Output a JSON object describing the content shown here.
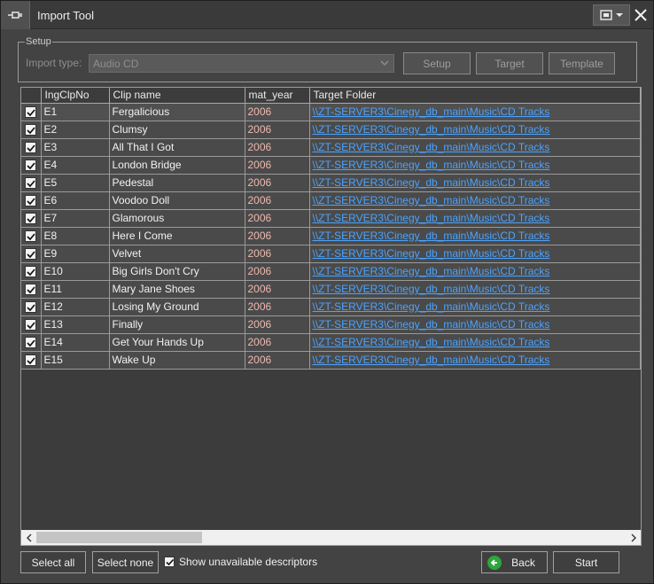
{
  "window": {
    "title": "Import Tool"
  },
  "setup": {
    "legend": "Setup",
    "import_type_label": "Import type:",
    "import_type_value": "Audio CD",
    "buttons": [
      "Setup",
      "Target",
      "Template"
    ]
  },
  "grid": {
    "columns": [
      "IngClpNo",
      "Clip name",
      "mat_year",
      "Target Folder"
    ],
    "rows": [
      {
        "checked": true,
        "no": "E1",
        "name": "Fergalicious",
        "year": "2006",
        "folder": "\\\\ZT-SERVER3\\Cinegy_db_main\\Music\\CD Tracks"
      },
      {
        "checked": true,
        "no": "E2",
        "name": "Clumsy",
        "year": "2006",
        "folder": "\\\\ZT-SERVER3\\Cinegy_db_main\\Music\\CD Tracks"
      },
      {
        "checked": true,
        "no": "E3",
        "name": "All That I Got",
        "year": "2006",
        "folder": "\\\\ZT-SERVER3\\Cinegy_db_main\\Music\\CD Tracks"
      },
      {
        "checked": true,
        "no": "E4",
        "name": "London Bridge",
        "year": "2006",
        "folder": "\\\\ZT-SERVER3\\Cinegy_db_main\\Music\\CD Tracks"
      },
      {
        "checked": true,
        "no": "E5",
        "name": "Pedestal",
        "year": "2006",
        "folder": "\\\\ZT-SERVER3\\Cinegy_db_main\\Music\\CD Tracks"
      },
      {
        "checked": true,
        "no": "E6",
        "name": "Voodoo Doll",
        "year": "2006",
        "folder": "\\\\ZT-SERVER3\\Cinegy_db_main\\Music\\CD Tracks"
      },
      {
        "checked": true,
        "no": "E7",
        "name": "Glamorous",
        "year": "2006",
        "folder": "\\\\ZT-SERVER3\\Cinegy_db_main\\Music\\CD Tracks"
      },
      {
        "checked": true,
        "no": "E8",
        "name": "Here I Come",
        "year": "2006",
        "folder": "\\\\ZT-SERVER3\\Cinegy_db_main\\Music\\CD Tracks"
      },
      {
        "checked": true,
        "no": "E9",
        "name": "Velvet",
        "year": "2006",
        "folder": "\\\\ZT-SERVER3\\Cinegy_db_main\\Music\\CD Tracks"
      },
      {
        "checked": true,
        "no": "E10",
        "name": "Big Girls Don't Cry",
        "year": "2006",
        "folder": "\\\\ZT-SERVER3\\Cinegy_db_main\\Music\\CD Tracks"
      },
      {
        "checked": true,
        "no": "E11",
        "name": "Mary Jane Shoes",
        "year": "2006",
        "folder": "\\\\ZT-SERVER3\\Cinegy_db_main\\Music\\CD Tracks"
      },
      {
        "checked": true,
        "no": "E12",
        "name": "Losing My Ground",
        "year": "2006",
        "folder": "\\\\ZT-SERVER3\\Cinegy_db_main\\Music\\CD Tracks"
      },
      {
        "checked": true,
        "no": "E13",
        "name": "Finally",
        "year": "2006",
        "folder": "\\\\ZT-SERVER3\\Cinegy_db_main\\Music\\CD Tracks"
      },
      {
        "checked": true,
        "no": "E14",
        "name": "Get Your Hands Up",
        "year": "2006",
        "folder": "\\\\ZT-SERVER3\\Cinegy_db_main\\Music\\CD Tracks"
      },
      {
        "checked": true,
        "no": "E15",
        "name": "Wake Up",
        "year": "2006",
        "folder": "\\\\ZT-SERVER3\\Cinegy_db_main\\Music\\CD Tracks"
      }
    ]
  },
  "footer": {
    "select_all": "Select all",
    "select_none": "Select none",
    "show_unavailable": "Show unavailable descriptors",
    "show_unavailable_checked": true,
    "back": "Back",
    "start": "Start"
  },
  "icons": {
    "app": "pin-icon",
    "menu": "settings-dropdown-icon",
    "close": "close-icon",
    "back": "back-arrow-icon"
  },
  "colors": {
    "link": "#4aa3ff",
    "year": "#f0b9b0",
    "back_icon": "#2ea63a"
  }
}
